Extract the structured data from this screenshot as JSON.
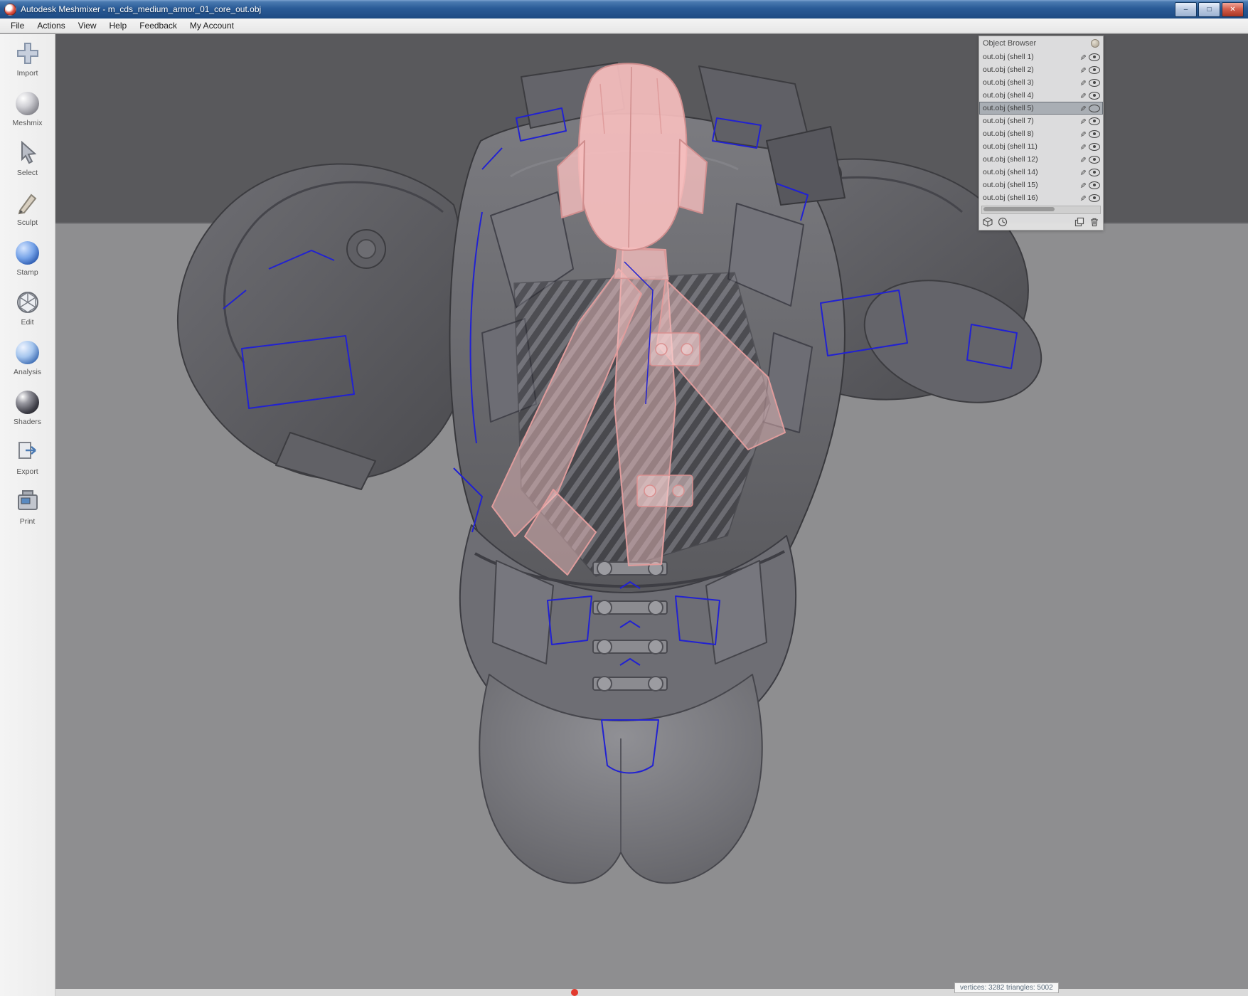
{
  "window": {
    "title": "Autodesk Meshmixer - m_cds_medium_armor_01_core_out.obj",
    "controls": {
      "minimize": "–",
      "maximize": "□",
      "close": "✕"
    }
  },
  "menu": {
    "items": [
      "File",
      "Actions",
      "View",
      "Help",
      "Feedback",
      "My Account"
    ]
  },
  "toolbar": {
    "items": [
      "Import",
      "Meshmix",
      "Select",
      "Sculpt",
      "Stamp",
      "Edit",
      "Analysis",
      "Shaders",
      "Export",
      "Print"
    ]
  },
  "object_browser": {
    "title": "Object Browser",
    "rows": [
      "out.obj (shell 1)",
      "out.obj (shell 2)",
      "out.obj (shell 3)",
      "out.obj (shell 4)",
      "out.obj (shell 5)",
      "out.obj (shell 7)",
      "out.obj (shell 8)",
      "out.obj (shell 11)",
      "out.obj (shell 12)",
      "out.obj (shell 14)",
      "out.obj (shell 15)",
      "out.obj (shell 16)"
    ],
    "selected_row": "out.obj (shell 5)"
  },
  "status": {
    "text": "vertices: 3282 triangles: 5002"
  },
  "colors": {
    "titlebar_blue": "#2a5b97",
    "selection_pink": "#f3b9b9",
    "wireframe_blue": "#2121d2",
    "viewport_top": "#59595c",
    "viewport_ground": "#8e8e90"
  }
}
